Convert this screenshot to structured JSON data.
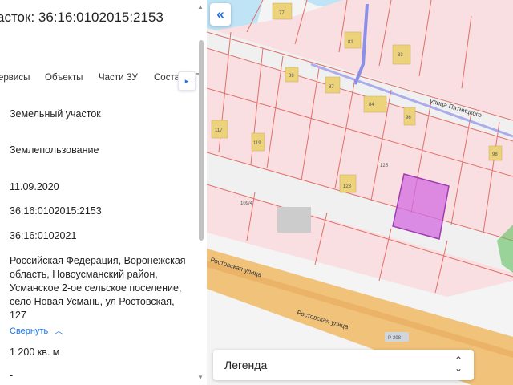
{
  "panel": {
    "title": "асток: 36:16:0102015:2153",
    "tabs": [
      {
        "label": "ервисы"
      },
      {
        "label": "Объекты"
      },
      {
        "label": "Части ЗУ"
      },
      {
        "label": "Соста"
      },
      {
        "label": "Г"
      }
    ],
    "tabs_arrow": "▸",
    "fields": [
      {
        "value": "Земельный участок"
      },
      {
        "value": "Землепользование"
      },
      {
        "value": "11.09.2020"
      },
      {
        "value": "36:16:0102015:2153"
      },
      {
        "value": "36:16:0102021"
      },
      {
        "value": "Российская Федерация, Воронежская область, Новоусманский район, Усманское 2-ое сельское поселение, село Новая Усмань, ул Ростовская, 127"
      },
      {
        "value": "1 200 кв. м"
      },
      {
        "value": "-"
      }
    ],
    "collapse_link": "Свернуть",
    "collapse_icon": "chevron-up-icon"
  },
  "map": {
    "collapse_button": "«",
    "legend_label": "Легенда",
    "legend_toggle_icon": "chevron-updown-icon",
    "street_labels": [
      {
        "text": "улица Пятницкого"
      },
      {
        "text": "Ростовская улица"
      },
      {
        "text": "Ростовская улица"
      }
    ],
    "road_badge": "Р-298",
    "house_numbers": [
      "77",
      "81",
      "83",
      "89",
      "87",
      "84",
      "96",
      "117",
      "119",
      "125",
      "123",
      "98",
      "109/4"
    ],
    "colors": {
      "parcel_fill": "#f9dfe1",
      "parcel_border": "#e0706a",
      "highlight_fill": "#d36be0",
      "highlight_border": "#a13bb0",
      "building": "#ecd27a",
      "water": "#bfe4f5",
      "road": "#f0f0f0",
      "major_road": "#f1c27a",
      "blue_boundary": "#8b8fe8",
      "green_area": "#5fbf5f"
    }
  }
}
